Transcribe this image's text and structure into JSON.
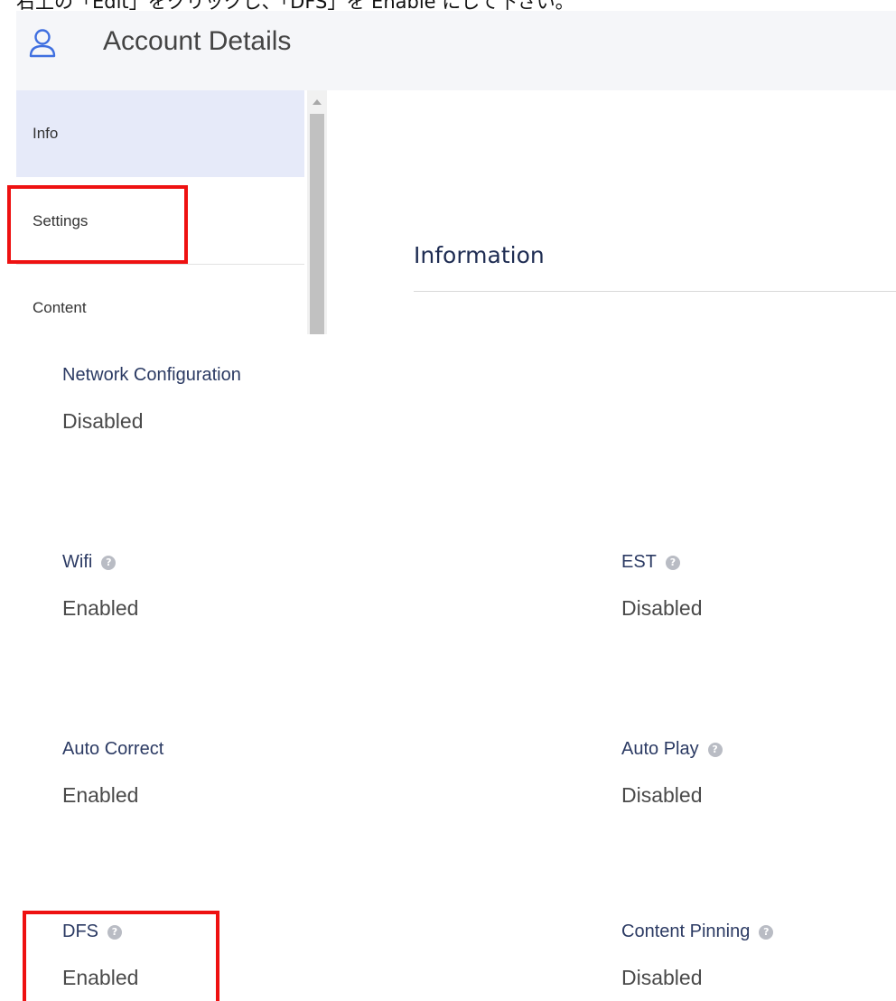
{
  "caption": "右上の「Edit」をクリックし、「DFS」を Enable にして下さい。",
  "header": {
    "title": "Account Details",
    "icon": "user-icon"
  },
  "sidebar": {
    "items": [
      {
        "label": "Info",
        "active": true
      },
      {
        "label": "Settings",
        "active": false
      },
      {
        "label": "Content",
        "active": false
      }
    ]
  },
  "section": {
    "title": "Information"
  },
  "fields": {
    "network_configuration": {
      "label": "Network Configuration",
      "value": "Disabled"
    },
    "wifi": {
      "label": "Wifi",
      "value": "Enabled",
      "help": true
    },
    "est": {
      "label": "EST",
      "value": "Disabled",
      "help": true
    },
    "auto_correct": {
      "label": "Auto Correct",
      "value": "Enabled"
    },
    "auto_play": {
      "label": "Auto Play",
      "value": "Disabled",
      "help": true
    },
    "dfs": {
      "label": "DFS",
      "value": "Enabled",
      "help": true
    },
    "content_pinning": {
      "label": "Content Pinning",
      "value": "Disabled",
      "help": true
    }
  },
  "help_glyph": "?",
  "colors": {
    "accent": "#3f6fe0",
    "highlight": "#ee1111",
    "active_bg": "#e6eaf9",
    "label": "#2b3a63"
  }
}
